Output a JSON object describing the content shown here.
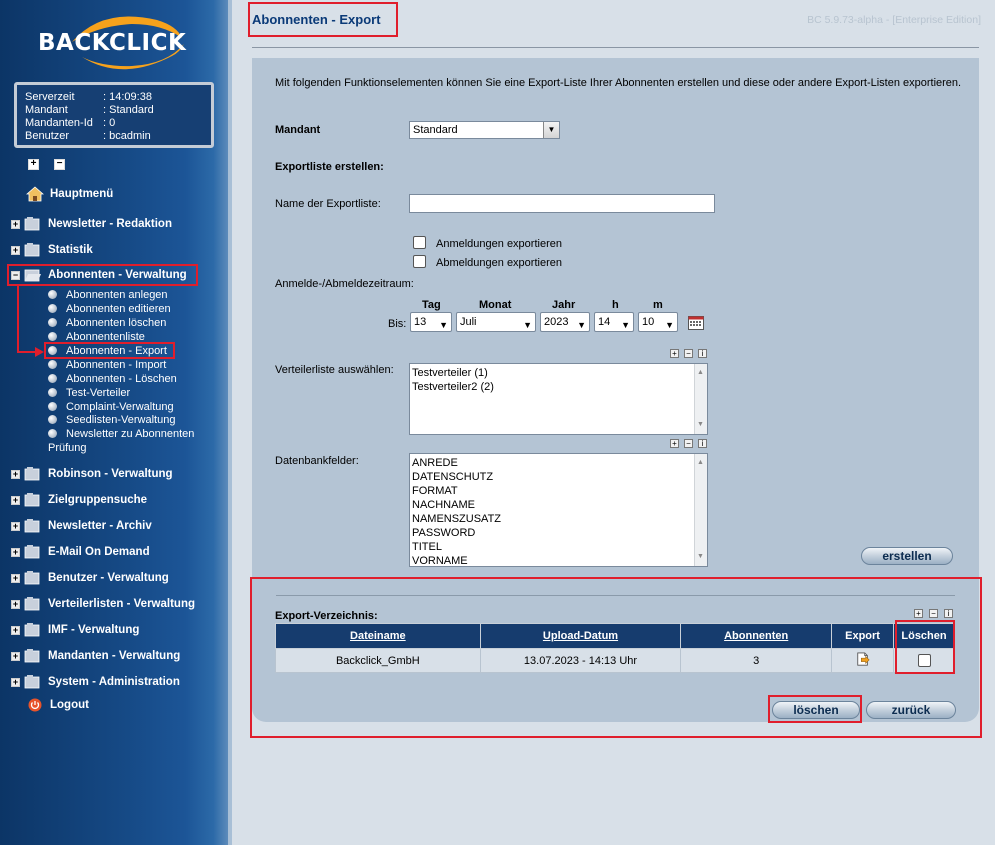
{
  "app": {
    "logo": "BACKCLICK",
    "version": "BC 5.9.73-alpha - [Enterprise Edition]"
  },
  "info": [
    {
      "k": "Serverzeit",
      "v": ": 14:09:38"
    },
    {
      "k": "Mandant",
      "v": ": Standard"
    },
    {
      "k": "Mandanten-Id",
      "v": ": 0"
    },
    {
      "k": "Benutzer",
      "v": ": bcadmin"
    }
  ],
  "tree": {
    "expand": "+",
    "collapse": "−"
  },
  "nav": {
    "hauptmenu": "Hauptmenü",
    "redaktion": "Newsletter - Redaktion",
    "statistik": "Statistik",
    "abonnenten": "Abonnenten - Verwaltung",
    "sub": [
      "Abonnenten anlegen",
      "Abonnenten editieren",
      "Abonnenten löschen",
      "Abonnentenliste",
      "Abonnenten - Export",
      "Abonnenten - Import",
      "Abonnenten - Löschen",
      "Test-Verteiler",
      "Complaint-Verwaltung",
      "Seedlisten-Verwaltung",
      "Newsletter zu Abonnenten"
    ],
    "sub_wrap": "Prüfung",
    "robinson": "Robinson - Verwaltung",
    "zielgruppen": "Zielgruppensuche",
    "archiv": "Newsletter - Archiv",
    "emod": "E-Mail On Demand",
    "benutzer": "Benutzer - Verwaltung",
    "verteiler": "Verteilerlisten - Verwaltung",
    "imf": "IMF - Verwaltung",
    "mandanten": "Mandanten - Verwaltung",
    "system": "System - Administration",
    "logout": "Logout"
  },
  "page": {
    "title": "Abonnenten - Export",
    "intro": "Mit folgenden Funktionselementen können Sie eine Export-Liste Ihrer Abonnenten erstellen und diese oder andere Export-Listen exportieren.",
    "mandant_label": "Mandant",
    "mandant_value": "Standard",
    "create_heading": "Exportliste erstellen:",
    "name_label": "Name der Exportliste:",
    "chk_anmeldungen": "Anmeldungen exportieren",
    "chk_abmeldungen": "Abmeldungen exportieren",
    "zeitraum_label": "Anmelde-/Abmeldezeitraum:",
    "col_tag": "Tag",
    "col_monat": "Monat",
    "col_jahr": "Jahr",
    "col_h": "h",
    "col_m": "m",
    "bis": "Bis:",
    "tag": "13",
    "monat": "Juli",
    "jahr": "2023",
    "h": "14",
    "m": "10",
    "verteiler_label": "Verteilerliste auswählen:",
    "verteiler": [
      "Testverteiler (1)",
      "Testverteiler2 (2)"
    ],
    "db_label": "Datenbankfelder:",
    "dbfields": [
      "ANREDE",
      "DATENSCHUTZ",
      "FORMAT",
      "NACHNAME",
      "NAMENSZUSATZ",
      "PASSWORD",
      "TITEL",
      "VORNAME"
    ],
    "btn_erstellen": "erstellen",
    "verz_heading": "Export-Verzeichnis:",
    "table": {
      "headers": [
        "Dateiname",
        "Upload-Datum",
        "Abonnenten",
        "Export",
        "Löschen"
      ],
      "rows": [
        {
          "file": "Backclick_GmbH",
          "date": "13.07.2023 - 14:13 Uhr",
          "abos": "3"
        }
      ]
    },
    "btn_loeschen": "löschen",
    "btn_zurueck": "zurück",
    "mini_plus": "+",
    "mini_minus": "−",
    "mini_info": "i"
  }
}
